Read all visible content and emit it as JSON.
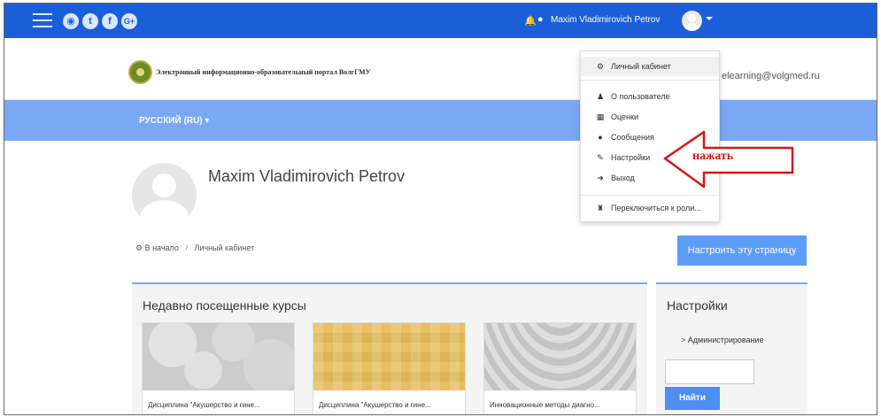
{
  "topbar": {
    "social": [
      {
        "name": "globe-icon",
        "glyph": "◉"
      },
      {
        "name": "twitter-icon",
        "glyph": "t"
      },
      {
        "name": "facebook-icon",
        "glyph": "f"
      },
      {
        "name": "google-plus-icon",
        "glyph": "G+"
      }
    ],
    "bell_glyph": "🔔",
    "chat_glyph": "●",
    "username": "Maxim Vladimirovich Petrov"
  },
  "header": {
    "portal_name": "Электронный информационно-образовательный портал ВолгГМУ",
    "email": "elearning@volgmed.ru"
  },
  "langbar": {
    "lang": "РУССКИЙ (RU) ▾"
  },
  "profile": {
    "name": "Maxim Vladimirovich Petrov",
    "breadcrumb_home": "В начало",
    "breadcrumb_sep": "/",
    "breadcrumb_current": "Личный кабинет",
    "customize_button": "Настроить эту страницу"
  },
  "courses": {
    "heading": "Недавно посещенные курсы",
    "items": [
      {
        "title": "Дисциплина \"Акушерство и гине..."
      },
      {
        "title": "Дисциплина \"Акушерство и гине..."
      },
      {
        "title": "Инновационные методы диагно..."
      }
    ]
  },
  "settings": {
    "heading": "Настройки",
    "admin_link": "> Администрирование",
    "search_button": "Найти"
  },
  "dropdown": {
    "items": [
      {
        "icon": "⚙",
        "label": "Личный кабинет"
      },
      {
        "icon": "♟",
        "label": "О пользователе"
      },
      {
        "icon": "▦",
        "label": "Оценки"
      },
      {
        "icon": "●",
        "label": "Сообщения"
      },
      {
        "icon": "✎",
        "label": "Настройки"
      },
      {
        "icon": "➜",
        "label": "Выход"
      },
      {
        "icon": "♜",
        "label": "Переключиться к роли..."
      }
    ]
  },
  "annotation": {
    "text": "нажать",
    "color": "#d91414"
  },
  "colors": {
    "topbar": "#1b5fd8",
    "langbar": "#7aa8f5",
    "button": "#5b9cf7"
  }
}
